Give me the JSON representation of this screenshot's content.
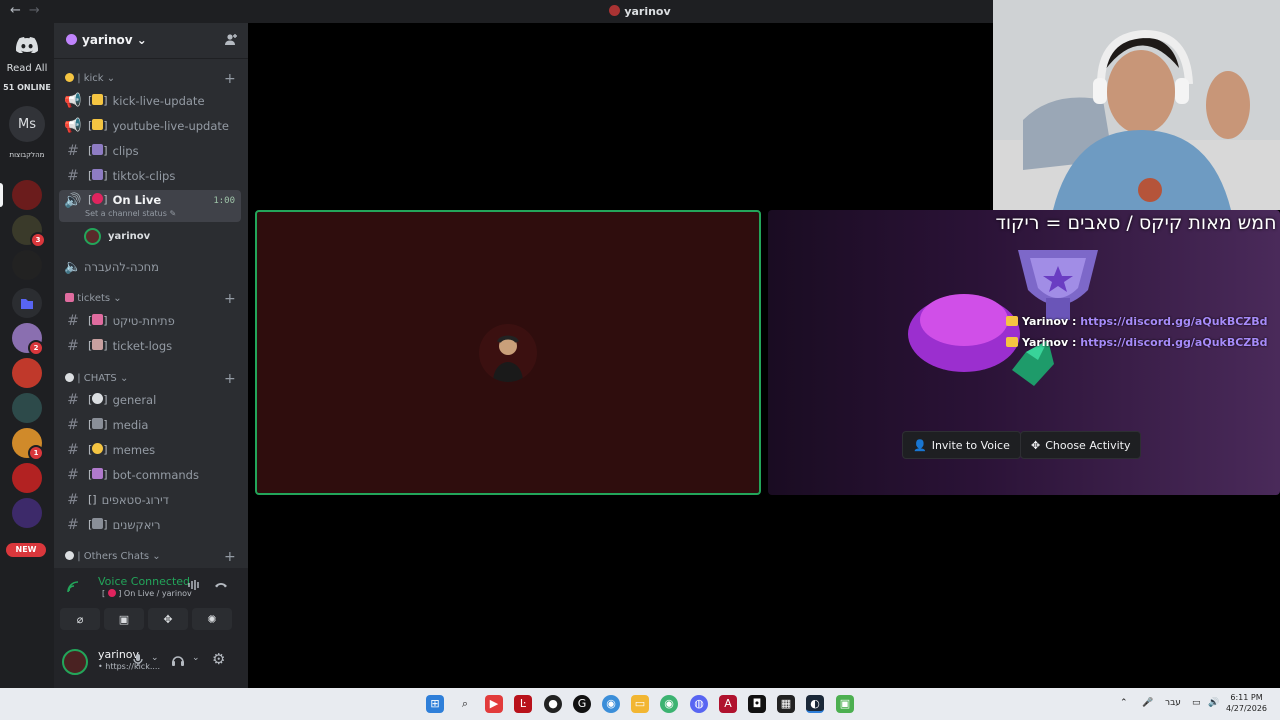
{
  "window": {
    "title": "yarinov"
  },
  "rail": {
    "read_all": "Read All",
    "online": "51 ONLINE",
    "ms_label": "Ms",
    "heb_label": "מהלקבוצות",
    "badges": [
      "3",
      "2",
      "1"
    ],
    "new_label": "NEW"
  },
  "sidebar": {
    "server_name": "yarinov",
    "categories": {
      "kick": "| kick",
      "tickets": "tickets",
      "chats": "| CHATS",
      "others": "| Others Chats"
    },
    "channels": {
      "kick_live_update": "kick-live-update",
      "youtube_live_update": "youtube-live-update",
      "clips": "clips",
      "tiktok_clips": "tiktok-clips",
      "on_live": "On Live",
      "on_live_timer": "1:00",
      "on_live_status": "Set a channel status",
      "waiting": "מחכה-להעברה",
      "open_ticket": "פתיחת-טיקט",
      "ticket_logs": "ticket-logs",
      "general": "general",
      "media": "media",
      "memes": "memes",
      "bot_commands": "bot-commands",
      "setups": "דירוג-סטאפים",
      "reactions": "ריאקשנים"
    },
    "voice_member": "yarinov"
  },
  "voice_panel": {
    "status": "Voice Connected",
    "channel": "On Live / yarinov"
  },
  "user_panel": {
    "username": "yarinov",
    "status": "• https://kick...."
  },
  "stage": {
    "overlay_text": "חמש מאות קיקס / סאבים = ריקוד",
    "chat_lines": [
      {
        "name": "Yarinov :",
        "link": "https://discord.gg/aQukBCZBd"
      },
      {
        "name": "Yarinov :",
        "link": "https://discord.gg/aQukBCZBd"
      }
    ],
    "invite_label": "Invite to Voice",
    "activity_label": "Choose Activity"
  },
  "taskbar": {
    "lang": "עבר",
    "time": "6:11 PM",
    "date": "4/27/2026"
  },
  "colors": {
    "green": "#23a55a",
    "tile_bg": "#2f0d0d",
    "link": "#a78bfa"
  }
}
